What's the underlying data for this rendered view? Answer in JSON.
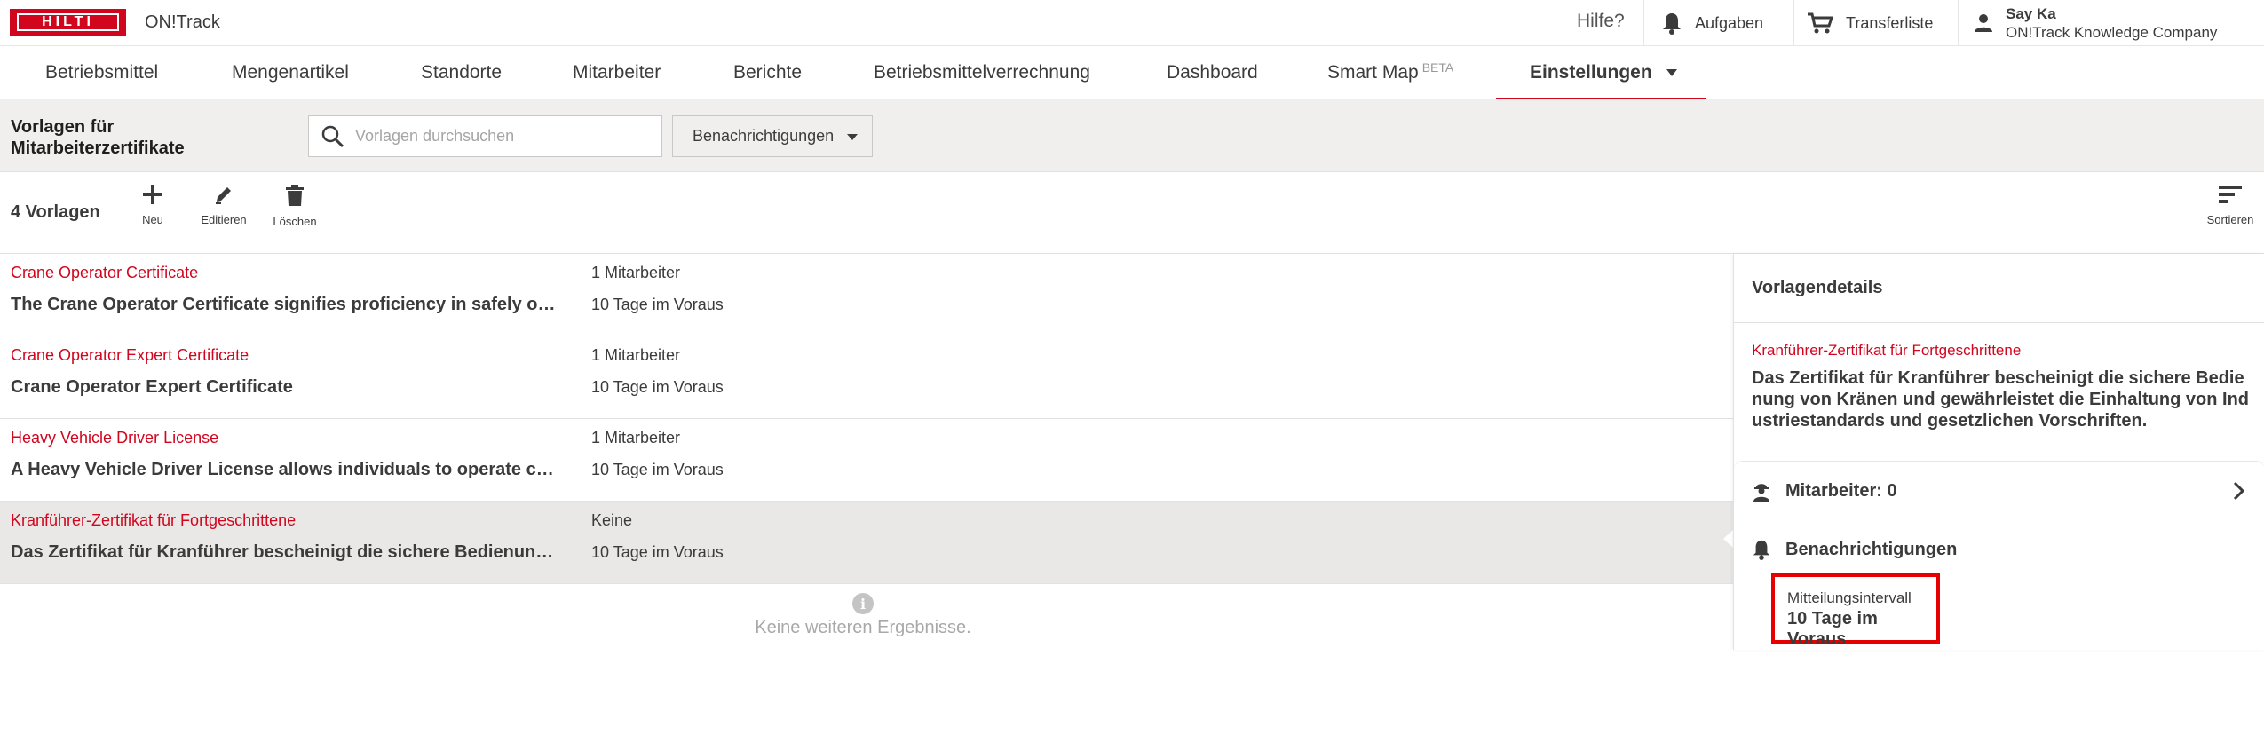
{
  "brand": {
    "logo_text": "HILTI",
    "app_title": "ON!Track",
    "accent": "#d2051e"
  },
  "topbar": {
    "help": "Hilfe?",
    "tasks": "Aufgaben",
    "transfer": "Transferliste",
    "user_name": "Say Ka",
    "user_company": "ON!Track Knowledge Company"
  },
  "nav": {
    "items": [
      {
        "label": "Betriebsmittel"
      },
      {
        "label": "Mengenartikel"
      },
      {
        "label": "Standorte"
      },
      {
        "label": "Mitarbeiter"
      },
      {
        "label": "Berichte"
      },
      {
        "label": "Betriebsmittelverrechnung"
      },
      {
        "label": "Dashboard"
      },
      {
        "label": "Smart Map",
        "sup": "BETA"
      },
      {
        "label": "Einstellungen"
      }
    ],
    "active": "Einstellungen"
  },
  "toolbar": {
    "title": "Vorlagen für Mitarbeiterzertifikate",
    "search_placeholder": "Vorlagen durchsuchen",
    "filter_selected": "Benachrichtigungen"
  },
  "actions": {
    "count": "4 Vorlagen",
    "new": "Neu",
    "edit": "Editieren",
    "delete": "Löschen",
    "sort": "Sortieren"
  },
  "rows": [
    {
      "name": "Crane Operator Certificate",
      "desc": "The Crane Operator Certificate signifies proficiency in safely operating cranes",
      "employees": "1 Mitarbeiter",
      "days": "10 Tage im Voraus"
    },
    {
      "name": "Crane Operator Expert Certificate",
      "desc": "Crane Operator Expert Certificate",
      "employees": "1 Mitarbeiter",
      "days": "10 Tage im Voraus"
    },
    {
      "name": "Heavy Vehicle Driver License",
      "desc": "A Heavy Vehicle Driver License allows individuals to operate commercial vehicles",
      "employees": "1 Mitarbeiter",
      "days": "10 Tage im Voraus"
    },
    {
      "name": "Kranführer-Zertifikat für Fortgeschrittene",
      "desc": "Das Zertifikat für Kranführer bescheinigt die sichere Bedienung von Kränen",
      "employees": "Keine",
      "days": "10 Tage im Voraus"
    }
  ],
  "no_more": "Keine weiteren Ergebnisse.",
  "detail": {
    "header": "Vorlagendetails",
    "name": "Kranführer-Zertifikat für Fortgeschrittene",
    "desc": "Das Zertifikat für Kranführer bescheinigt die sichere Bedienung von Kränen und gewährleistet die Einhaltung von Industriestandards und gesetzlichen Vorschriften.",
    "employees": "Mitarbeiter: 0",
    "notifications": "Benachrichtigungen",
    "interval_label": "Mitteilungsintervall",
    "interval_value": "10 Tage im Voraus"
  }
}
